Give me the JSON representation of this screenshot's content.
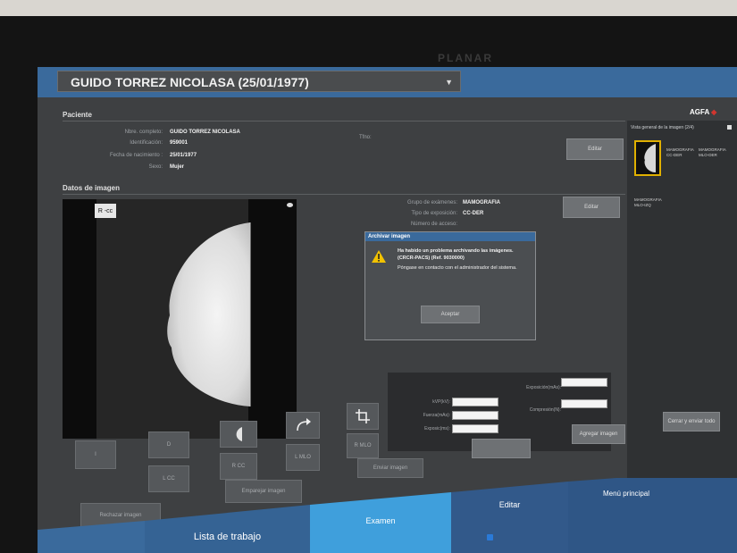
{
  "monitor": {
    "brand": "PLANAR"
  },
  "header": {
    "patient_selector": "GUIDO TORREZ NICOLASA (25/01/1977)",
    "logo": "AGFA"
  },
  "patient": {
    "section_title": "Paciente",
    "full_name_label": "Nbre. completo:",
    "full_name": "GUIDO TORREZ NICOLASA",
    "id_label": "Identificación:",
    "id": "959001",
    "birth_label": "Fecha de nacimiento :",
    "birth": "25/01/1977",
    "sex_label": "Sexo:",
    "sex": "Mujer",
    "tfno_label": "Tfno:",
    "edit_button": "Editar"
  },
  "image_data": {
    "section_title": "Datos de imagen",
    "orientation_tag": "R -cc",
    "exam_group_label": "Grupo de exámenes:",
    "exam_group": "MAMOGRAFIA",
    "exposure_type_label": "Tipo de exposición:",
    "exposure_type": "CC-DER",
    "access_label": "Número de acceso:",
    "edit_button": "Editar"
  },
  "dialog": {
    "title": "Archivar imagen",
    "message": "Ha habido un problema archivando las imágenes. (CRCR-PACS) (Ref. 9030000)",
    "detail": "Póngase en contacto con el administrador del sistema.",
    "ok_button": "Aceptar"
  },
  "exposure": {
    "kvp_label": "kVP(kV):",
    "current_label": "Fuerza(mAs):",
    "time_label": "Exposic(ms):",
    "exposure_label": "Exposición(mAs):",
    "compression_label": "Compresión(N):"
  },
  "view_buttons": {
    "b1": "I",
    "b2": "D",
    "b3": "L CC",
    "b4": "R CC",
    "b5": "L MLO",
    "b6": "R MLO"
  },
  "actions": {
    "reject": "Rechazar imagen",
    "unpair": "Emparejar imagen",
    "send": "Enviar imagen",
    "add_image": "Agregar imagen",
    "close_exam": "Cerrar y enviar todo"
  },
  "right_panel": {
    "title": "Vista general de la imagen (2/4)",
    "thumb1_label": "MAMOGRAFIA CC-DER",
    "thumb2_label": "MAMOGRAFIA MLO-DER",
    "thumb3_label": "MAMOGRAFIA MLO-IZQ"
  },
  "tabs": {
    "worklist": "Lista de trabajo",
    "exam": "Examen",
    "edit": "Editar",
    "main_menu": "Menú principal"
  },
  "colors": {
    "accent_blue": "#3a6a9c",
    "active_tab": "#3f9fdc",
    "thumb_highlight": "#e0b000"
  }
}
